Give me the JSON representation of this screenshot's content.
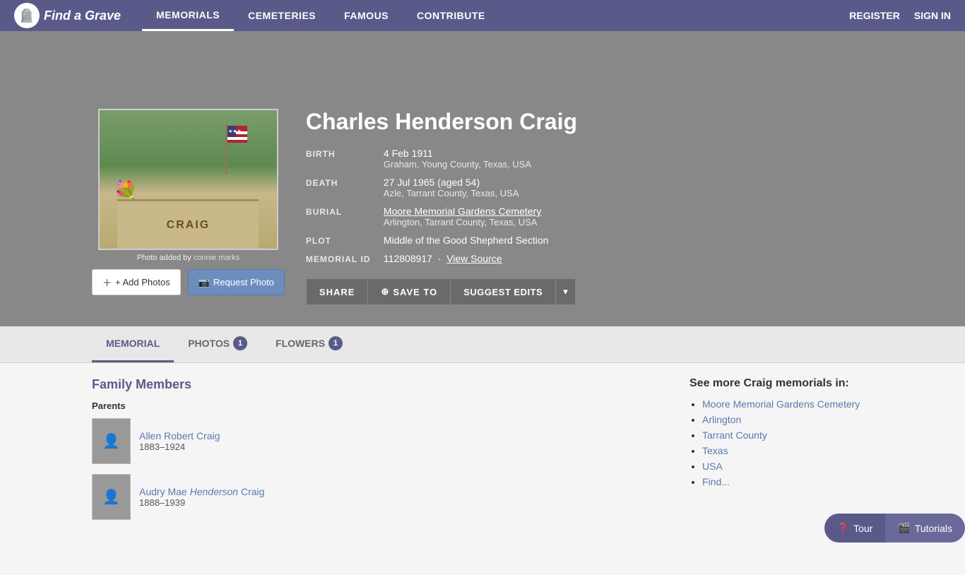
{
  "nav": {
    "logo_text": "Find a Grave",
    "links": [
      {
        "label": "MEMORIALS",
        "active": true
      },
      {
        "label": "CEMETERIES",
        "active": false
      },
      {
        "label": "FAMOUS",
        "active": false
      },
      {
        "label": "CONTRIBUTE",
        "active": false
      }
    ],
    "right_links": [
      {
        "label": "REGISTER"
      },
      {
        "label": "SIGN IN"
      }
    ]
  },
  "person": {
    "name": "Charles Henderson Craig",
    "birth_label": "BIRTH",
    "birth_date": "4 Feb 1911",
    "birth_place": "Graham, Young County, Texas, USA",
    "death_label": "DEATH",
    "death_date": "27 Jul 1965 (aged 54)",
    "death_place": "Azle, Tarrant County, Texas, USA",
    "burial_label": "BURIAL",
    "burial_cemetery": "Moore Memorial Gardens Cemetery",
    "burial_place": "Arlington, Tarrant County, Texas, USA",
    "plot_label": "PLOT",
    "plot_value": "Middle of the Good Shepherd Section",
    "memorial_id_label": "MEMORIAL ID",
    "memorial_id": "112808917",
    "view_source_label": "View Source"
  },
  "photo": {
    "credit_prefix": "Photo added by",
    "credit_user": "connie marks"
  },
  "buttons": {
    "add_photos": "+ Add Photos",
    "request_photo": "📷 Request Photo",
    "share": "SHARE",
    "save_to": "SAVE TO",
    "suggest_edits": "SUGGEST EDITS"
  },
  "tabs": [
    {
      "label": "MEMORIAL",
      "active": true,
      "badge": null
    },
    {
      "label": "PHOTOS",
      "active": false,
      "badge": "1"
    },
    {
      "label": "FLOWERS",
      "active": false,
      "badge": "1"
    }
  ],
  "family": {
    "title": "Family Members",
    "parents_label": "Parents",
    "members": [
      {
        "name": "Allen Robert Craig",
        "years": "1883–1924",
        "italic_part": null
      },
      {
        "name_start": "Audry Mae ",
        "name_italic": "Henderson",
        "name_end": " Craig",
        "years": "1888–1939"
      }
    ]
  },
  "sidebar": {
    "title_prefix": "See more ",
    "title_name": "Craig",
    "title_suffix": " memorials in:",
    "links": [
      "Moore Memorial Gardens Cemetery",
      "Arlington",
      "Tarrant County",
      "Texas",
      "USA",
      "Find..."
    ]
  },
  "tour_bar": {
    "tour_label": "Tour",
    "tutorials_label": "Tutorials"
  }
}
